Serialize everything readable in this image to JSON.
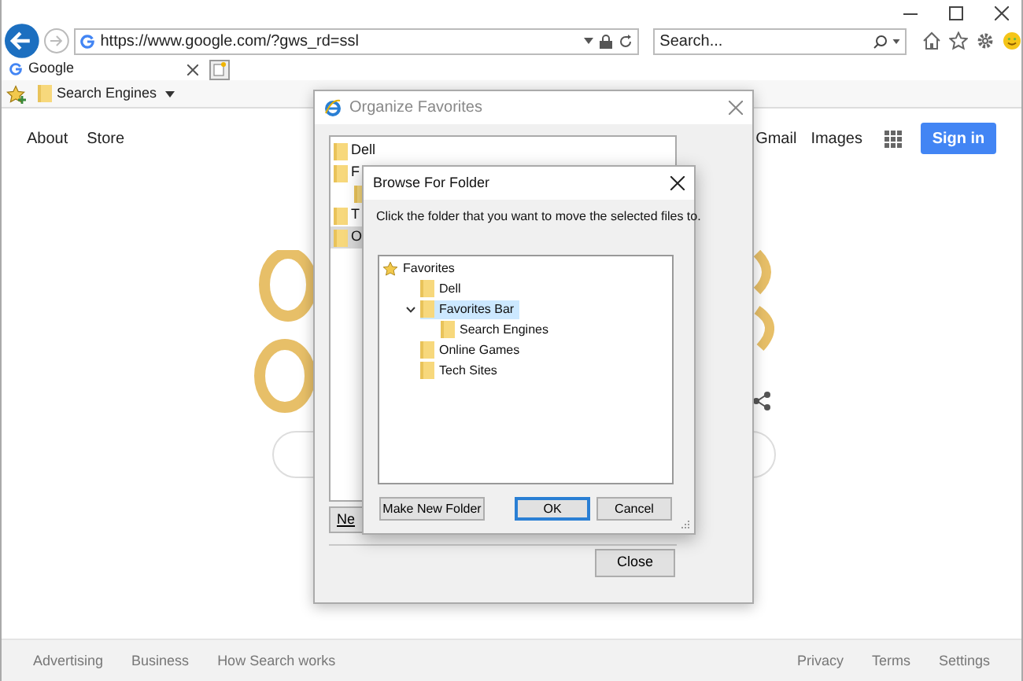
{
  "browser": {
    "address": "https://www.google.com/?gws_rd=ssl",
    "search_placeholder": "Search...",
    "tabs": [
      {
        "title": "Google",
        "selected": true
      }
    ],
    "favorites_bar": [
      {
        "label": "Search Engines"
      }
    ]
  },
  "page": {
    "nav_left": [
      "About",
      "Store"
    ],
    "nav_right": [
      "Gmail",
      "Images"
    ],
    "sign_in": "Sign in",
    "footer_left": [
      "Advertising",
      "Business",
      "How Search works"
    ],
    "footer_right": [
      "Privacy",
      "Terms",
      "Settings"
    ]
  },
  "organize_favorites": {
    "title": "Organize Favorites",
    "items": [
      {
        "label": "Dell",
        "selected": false
      },
      {
        "label": "F",
        "selected": false,
        "children": [
          {
            "kind": "folder"
          }
        ]
      },
      {
        "label": "T",
        "selected": false
      },
      {
        "label": "O",
        "selected": true
      }
    ],
    "new_button": "Ne",
    "close_button": "Close"
  },
  "browse_for_folder": {
    "title": "Browse For Folder",
    "instruction": "Click the folder that you want to move the selected files to.",
    "root": {
      "label": "Favorites",
      "children": [
        {
          "label": "Dell",
          "selected": false
        },
        {
          "label": "Favorites Bar",
          "selected": true,
          "expanded": true,
          "children": [
            {
              "label": "Search Engines",
              "selected": false
            }
          ]
        },
        {
          "label": "Online Games",
          "selected": false
        },
        {
          "label": "Tech Sites",
          "selected": false
        }
      ]
    },
    "buttons": [
      {
        "label": "Make New Folder",
        "focused": false
      },
      {
        "label": "OK",
        "focused": true
      },
      {
        "label": "Cancel",
        "focused": false
      }
    ]
  }
}
